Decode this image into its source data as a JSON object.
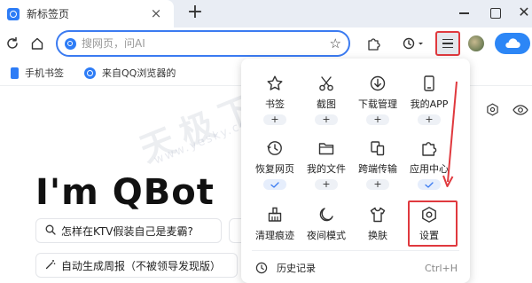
{
  "tab": {
    "title": "新标签页",
    "close": "×",
    "new_tab": "+"
  },
  "window": {
    "close": "✕"
  },
  "address_bar": {
    "placeholder": "搜网页，问AI"
  },
  "bookmarks": {
    "items": [
      {
        "label": "手机书签"
      },
      {
        "label": "来自QQ浏览器的"
      }
    ]
  },
  "page": {
    "title": "I'm QBot",
    "suggestions": [
      {
        "label": "怎样在KTV假装自己是麦霸?"
      },
      {
        "label": "自动生成周报（不被领导发现版）"
      }
    ]
  },
  "menu": {
    "row1": [
      {
        "label": "书签",
        "icon": "star-icon",
        "badge": "+"
      },
      {
        "label": "截图",
        "icon": "scissors-icon",
        "badge": "+"
      },
      {
        "label": "下载管理",
        "icon": "download-icon",
        "badge": "+"
      },
      {
        "label": "我的APP",
        "icon": "phone-icon",
        "badge": "+"
      }
    ],
    "row2": [
      {
        "label": "恢复网页",
        "icon": "restore-icon",
        "badge": "check"
      },
      {
        "label": "我的文件",
        "icon": "folder-icon",
        "badge": "+"
      },
      {
        "label": "跨端传输",
        "icon": "transfer-icon",
        "badge": "+"
      },
      {
        "label": "应用中心",
        "icon": "puzzle-icon",
        "badge": "check"
      }
    ],
    "row3": [
      {
        "label": "清理痕迹",
        "icon": "broom-icon"
      },
      {
        "label": "夜间模式",
        "icon": "moon-icon"
      },
      {
        "label": "换肤",
        "icon": "shirt-icon"
      },
      {
        "label": "设置",
        "icon": "settings-icon"
      }
    ],
    "history": {
      "label": "历史记录",
      "shortcut": "Ctrl+H"
    }
  },
  "watermark": {
    "text": "天极下载站",
    "url": "www.yesky.com"
  },
  "colors": {
    "accent": "#3b7bf1",
    "annotation": "#e0393e",
    "brand": "#2d7cf6"
  }
}
